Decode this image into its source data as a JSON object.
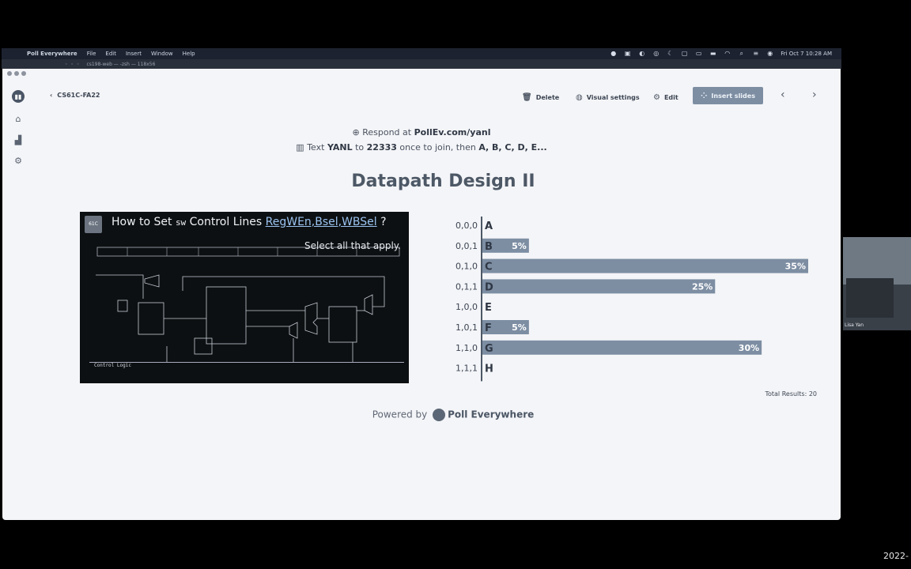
{
  "menubar": {
    "app_name": "Poll Everywhere",
    "menus": [
      "File",
      "Edit",
      "Insert",
      "Window",
      "Help"
    ],
    "clock": "Fri Oct 7  10:28 AM"
  },
  "terminal": {
    "title": "cs198-web — -zsh — 118x56"
  },
  "toolbar": {
    "back_label": "CS61C-FA22",
    "delete_label": "Delete",
    "visual_settings_label": "Visual settings",
    "edit_label": "Edit",
    "insert_slides_label": "Insert slides"
  },
  "respond": {
    "line1_prefix": "Respond at ",
    "line1_url": "PollEv.com/yanl",
    "line2_prefix": "Text ",
    "line2_code": "YANL",
    "line2_to": " to ",
    "line2_number": "22333",
    "line2_mid": " once to join, then ",
    "line2_options": "A, B, C, D, E..."
  },
  "poll_title": "Datapath Design II",
  "slide": {
    "title_prefix": "How to Set ",
    "title_mono": "sw",
    "title_mid": " Control Lines ",
    "title_signals": "RegWEn,Bsel,WBSel",
    "title_suffix": " ?",
    "subtitle": "Select all that apply.",
    "control_label": "Control Logic"
  },
  "chart_data": {
    "type": "bar",
    "orientation": "horizontal",
    "categories": [
      "0,0,0",
      "0,0,1",
      "0,1,0",
      "0,1,1",
      "1,0,0",
      "1,0,1",
      "1,1,0",
      "1,1,1"
    ],
    "letters": [
      "A",
      "B",
      "C",
      "D",
      "E",
      "F",
      "G",
      "H"
    ],
    "values": [
      0,
      5,
      35,
      25,
      0,
      5,
      30,
      0
    ],
    "value_labels": [
      "",
      "5%",
      "35%",
      "25%",
      "",
      "5%",
      "30%",
      ""
    ],
    "xlim": [
      0,
      35
    ],
    "bar_color": "#7d8ea3",
    "title": "",
    "xlabel": "",
    "ylabel": ""
  },
  "total_results": "Total Results: 20",
  "powered": {
    "prefix": "Powered by ",
    "brand": "Poll Everywhere"
  },
  "webcam": {
    "name": "Lisa Yan"
  },
  "corner_date": "2022-"
}
